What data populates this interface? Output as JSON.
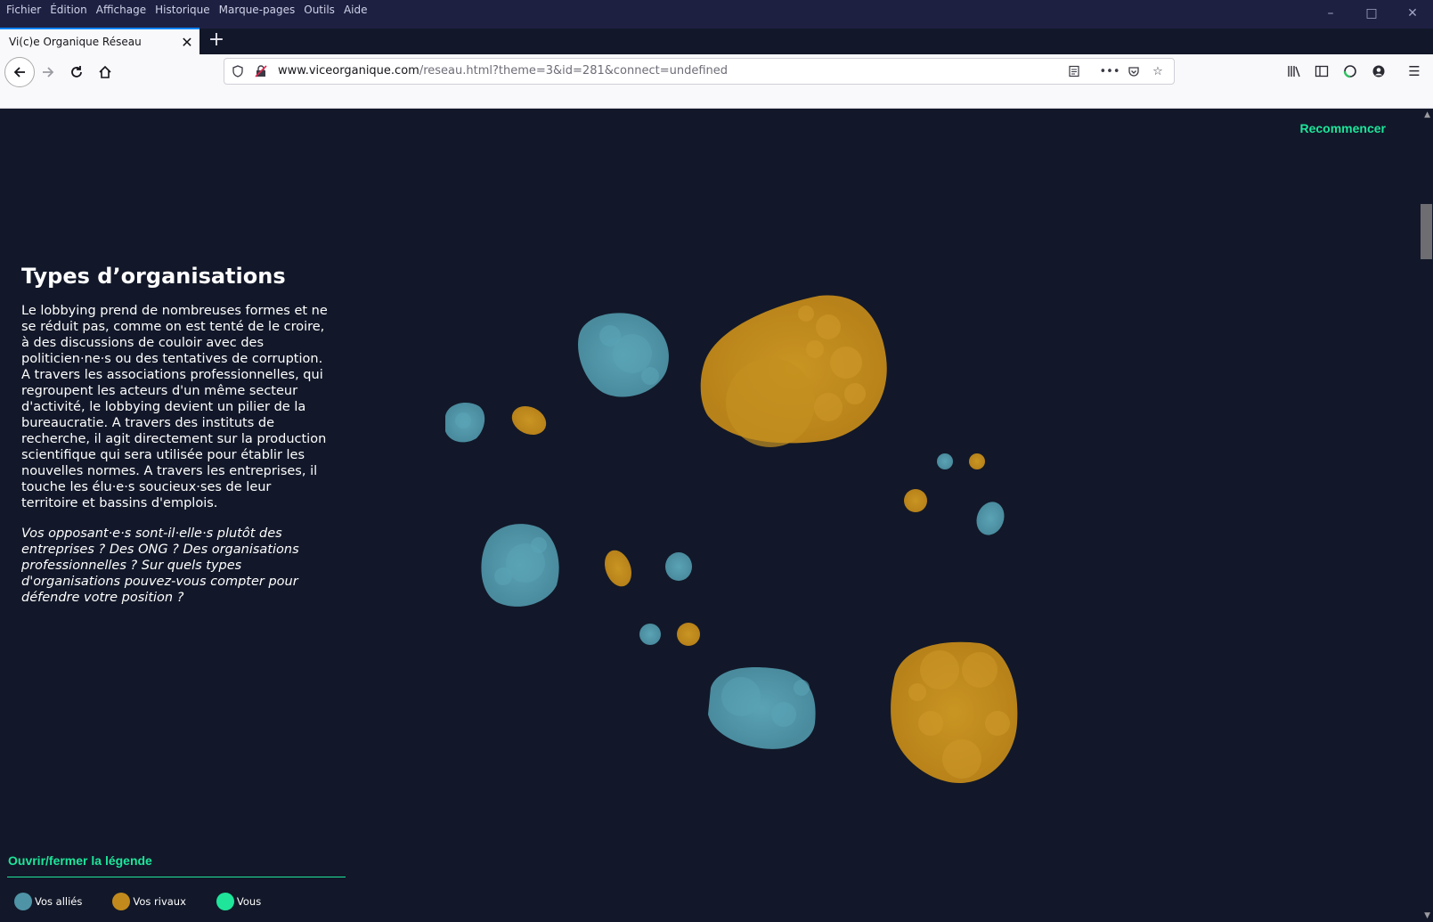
{
  "menubar": [
    "Fichier",
    "Édition",
    "Affichage",
    "Historique",
    "Marque-pages",
    "Outils",
    "Aide"
  ],
  "tab": {
    "title": "Vi(c)e Organique Réseau"
  },
  "url": {
    "domain": "www.viceorganique.com",
    "path": "/reseau.html?theme=3&id=281&connect=undefined"
  },
  "page": {
    "restart_label": "Recommencer",
    "title": "Types d’organisations",
    "body": "Le lobbying prend de nombreuses formes et ne se réduit pas, comme on est tenté de le croire, à des discussions de couloir avec des politicien·ne·s ou des tentatives de corruption. A travers les associations professionnelles, qui regroupent les acteurs d'un même secteur d'activité, le lobbying devient un pilier de la bureaucratie. A travers des instituts de recherche, il agit directement sur la production scientifique qui sera utilisée pour établir les nouvelles normes. A travers les entreprises, il touche les élu·e·s soucieux·ses de leur territoire et bassins d'emplois.",
    "question": "Vos opposant·e·s sont-il·elle·s plutôt des entreprises ? Des ONG ? Des organisations professionnelles ? Sur quels types d'organisations pouvez-vous compter pour défendre votre position ?",
    "legend_toggle": "Ouvrir/fermer la légende",
    "legend": [
      {
        "label": "Vos alliés",
        "color": "#4f93a6"
      },
      {
        "label": "Vos rivaux",
        "color": "#c28a1c"
      },
      {
        "label": "Vous",
        "color": "#1ee59a"
      }
    ]
  },
  "colors": {
    "ally": "#4f93a6",
    "rival": "#c28a1c",
    "you": "#1ee59a",
    "background": "#121829"
  }
}
